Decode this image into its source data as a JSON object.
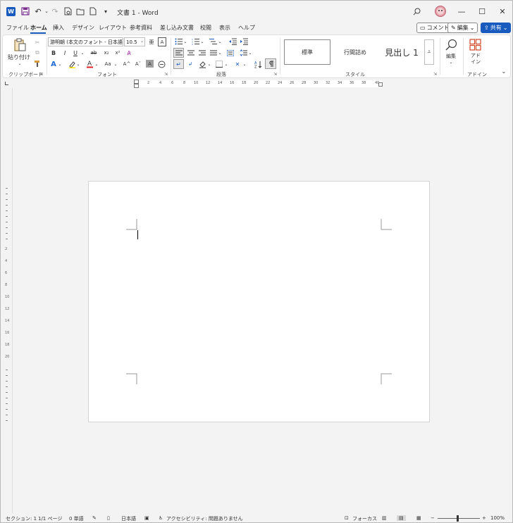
{
  "title": {
    "document_title": "文書 1 - Word",
    "autosave_icon": "save-icon",
    "undo_icon": "undo-icon",
    "redo_icon": "redo-icon"
  },
  "window_controls": {
    "minimize": "—",
    "maximize": "☐",
    "close": "✕"
  },
  "menu": {
    "tabs": [
      "ファイル",
      "ホーム",
      "挿入",
      "デザイン",
      "レイアウト",
      "参考資料",
      "差し込み文書",
      "校閲",
      "表示",
      "ヘルプ"
    ],
    "active_tab": "ホーム",
    "comment_label": "コメント",
    "edit_label": "編集",
    "share_label": "共有"
  },
  "ribbon": {
    "clipboard": {
      "paste_label": "貼り付け",
      "group_label": "クリップボード"
    },
    "font": {
      "font_name": "游明朝 (本文のフォント - 日本語)",
      "font_size": "10.5",
      "bold": "B",
      "italic": "I",
      "underline": "U",
      "strike": "ab",
      "subscript": "x₂",
      "superscript": "x²",
      "change_case": "Aa",
      "grow_font": "A^",
      "shrink_font": "Aˇ",
      "char_shading": "A",
      "group_label": "フォント"
    },
    "paragraph": {
      "group_label": "段落"
    },
    "styles": {
      "items": [
        "標準",
        "行間詰め",
        "見出し 1"
      ],
      "group_label": "スタイル"
    },
    "editing": {
      "label": "編集"
    },
    "addins": {
      "label": "アド\nイン",
      "group_label": "アドイン"
    }
  },
  "ruler": {
    "numbers": [
      "2",
      "4",
      "6",
      "8",
      "10",
      "12",
      "14",
      "16",
      "18",
      "20",
      "22",
      "24",
      "26",
      "28",
      "30",
      "32",
      "34",
      "36",
      "38",
      "40"
    ]
  },
  "vruler": {
    "numbers": [
      "2",
      "4",
      "6",
      "8",
      "10",
      "12",
      "14",
      "16",
      "18",
      "20"
    ]
  },
  "status": {
    "section": "セクション: 1",
    "page": "1/1 ページ",
    "words": "0 単語",
    "language": "日本語",
    "accessibility": "アクセシビリティ: 問題ありません",
    "focus": "フォーカス",
    "zoom": "100%",
    "zoom_minus": "−",
    "zoom_plus": "+"
  }
}
